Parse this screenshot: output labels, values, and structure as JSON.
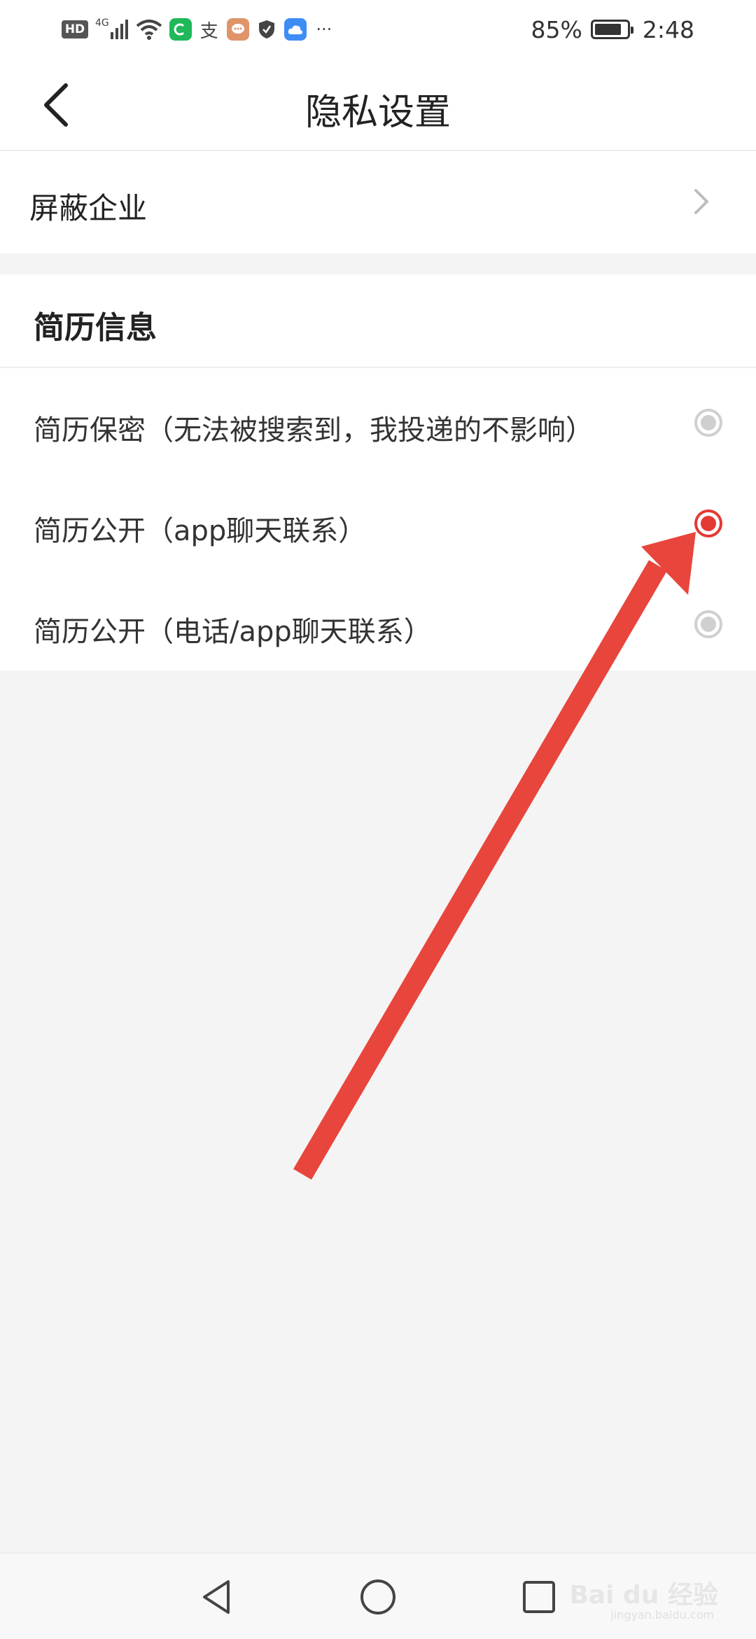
{
  "status_bar": {
    "left_icons": [
      "hd-icon",
      "signal-4g-icon",
      "wifi-icon",
      "app-green-icon",
      "alipay-icon",
      "chat-bubble-icon",
      "shield-icon",
      "cloud-icon",
      "more-dots-icon"
    ],
    "hd": "HD",
    "network": "4G",
    "alipay": "支",
    "more": "···",
    "battery_percent_text": "85%",
    "battery_level": 0.85,
    "time": "2:48"
  },
  "header": {
    "title": "隐私设置",
    "back_icon": "chevron-left-icon"
  },
  "block_row": {
    "label": "屏蔽企业",
    "chevron_icon": "chevron-right-icon"
  },
  "resume_section": {
    "title": "简历信息",
    "options": [
      {
        "label": "简历保密（无法被搜索到，我投递的不影响）",
        "selected": false
      },
      {
        "label": "简历公开（app聊天联系）",
        "selected": true
      },
      {
        "label": "简历公开（电话/app聊天联系）",
        "selected": false
      }
    ]
  },
  "system_nav": {
    "buttons": [
      "back-triangle-icon",
      "home-circle-icon",
      "recents-square-icon"
    ]
  },
  "watermark": {
    "text": "Bai du 经验",
    "sub": "jingyan.baidu.com"
  },
  "colors": {
    "accent": "#e53935",
    "arrow": "#e8453c",
    "radio_off": "#cfcfcf",
    "page_bg": "#f4f4f4"
  }
}
